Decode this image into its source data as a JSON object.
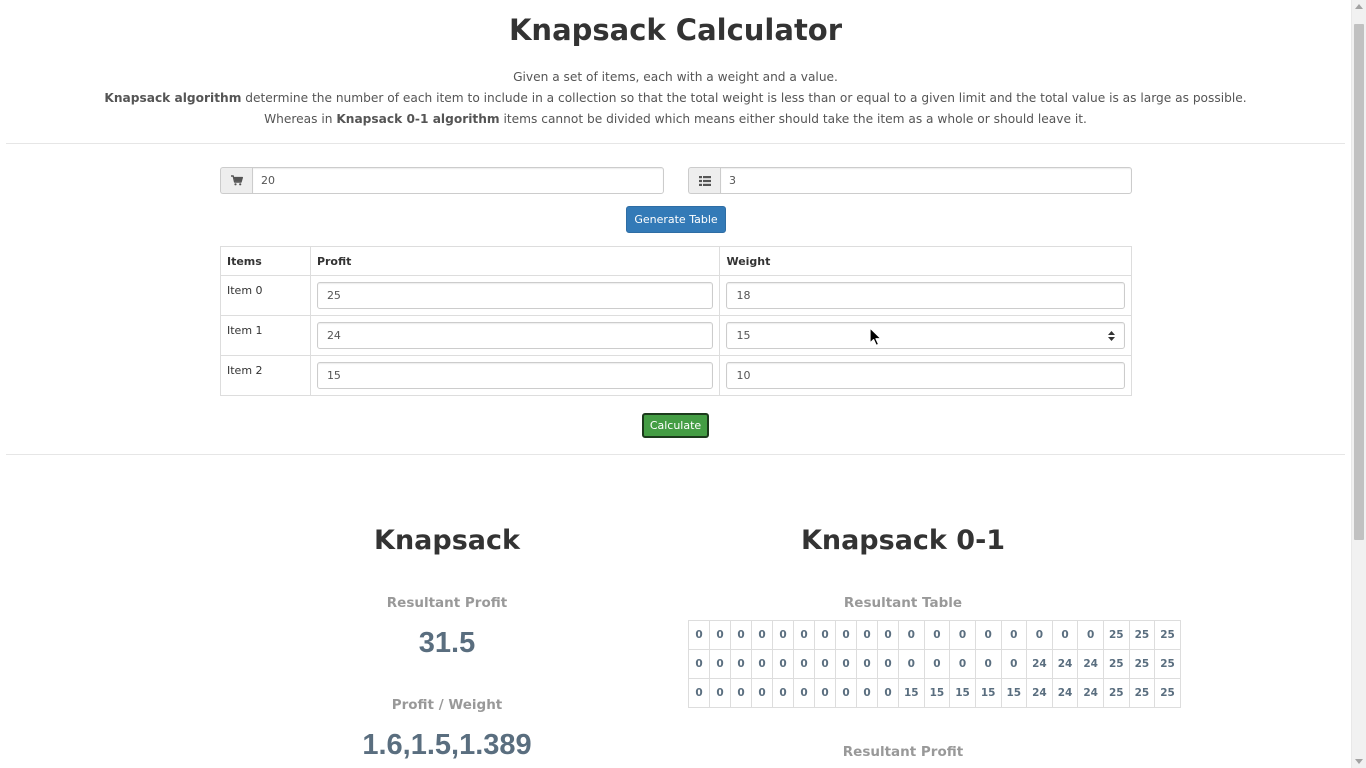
{
  "header": {
    "title": "Knapsack Calculator",
    "desc_line1": "Given a set of items, each with a weight and a value.",
    "desc_line2_bold": "Knapsack algorithm",
    "desc_line2_rest": " determine the number of each item to include in a collection so that the total weight is less than or equal to a given limit and the total value is as large as possible.",
    "desc_line3_pre": "Whereas in ",
    "desc_line3_bold": "Knapsack 0-1 algorithm",
    "desc_line3_rest": " items cannot be divided which means either should take the item as a whole or should leave it."
  },
  "inputs": {
    "capacity": {
      "icon": "shopping-cart-icon",
      "value": "20"
    },
    "item_count": {
      "icon": "list-icon",
      "value": "3"
    }
  },
  "buttons": {
    "generate": "Generate Table",
    "calculate": "Calculate"
  },
  "items_table": {
    "headers": [
      "Items",
      "Profit",
      "Weight"
    ],
    "rows": [
      {
        "label": "Item 0",
        "profit": "25",
        "weight": "18"
      },
      {
        "label": "Item 1",
        "profit": "24",
        "weight": "15"
      },
      {
        "label": "Item 2",
        "profit": "15",
        "weight": "10"
      }
    ]
  },
  "knapsack": {
    "title": "Knapsack",
    "profit_label": "Resultant Profit",
    "profit_value": "31.5",
    "ratio_label": "Profit / Weight",
    "ratio_value": "1.6,1.5,1.389"
  },
  "knapsack01": {
    "title": "Knapsack 0-1",
    "table_label": "Resultant Table",
    "table": [
      [
        "0",
        "0",
        "0",
        "0",
        "0",
        "0",
        "0",
        "0",
        "0",
        "0",
        "0",
        "0",
        "0",
        "0",
        "0",
        "0",
        "0",
        "0",
        "25",
        "25",
        "25"
      ],
      [
        "0",
        "0",
        "0",
        "0",
        "0",
        "0",
        "0",
        "0",
        "0",
        "0",
        "0",
        "0",
        "0",
        "0",
        "0",
        "24",
        "24",
        "24",
        "25",
        "25",
        "25"
      ],
      [
        "0",
        "0",
        "0",
        "0",
        "0",
        "0",
        "0",
        "0",
        "0",
        "0",
        "15",
        "15",
        "15",
        "15",
        "15",
        "24",
        "24",
        "24",
        "25",
        "25",
        "25"
      ]
    ],
    "profit_label": "Resultant Profit"
  },
  "colors": {
    "primary": "#337ab7",
    "success": "#449d44",
    "result_value": "#5a6e7f",
    "muted_label": "#999999"
  }
}
